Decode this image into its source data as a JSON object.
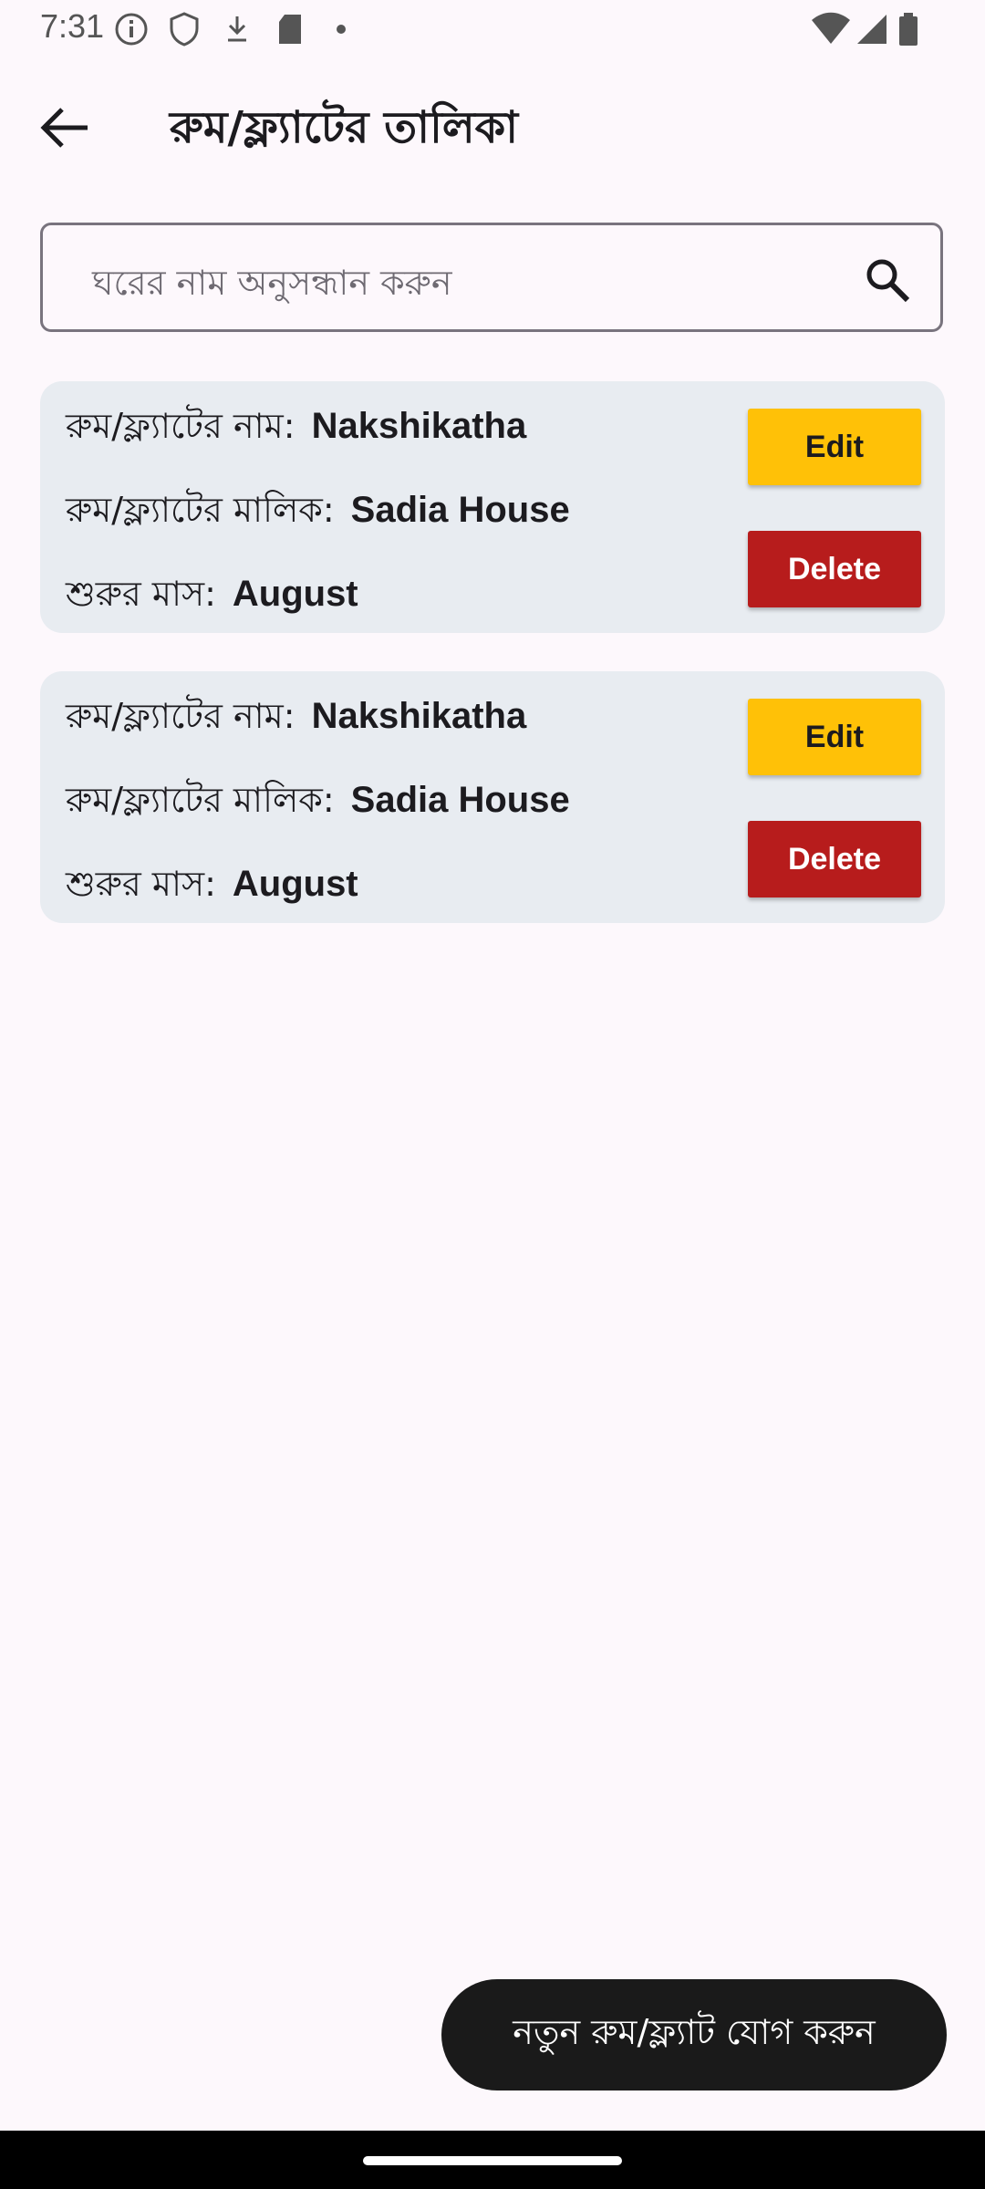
{
  "status_bar": {
    "time": "7:31",
    "left_icons": [
      "info-icon",
      "shield-icon",
      "download-icon",
      "sd-card-icon",
      "dot-icon"
    ],
    "right_icons": [
      "wifi-icon",
      "signal-icon",
      "battery-icon"
    ]
  },
  "app_bar": {
    "title": "রুম/ফ্ল্যাটের তালিকা",
    "back_icon": "arrow-left-icon"
  },
  "search": {
    "placeholder": "ঘরের নাম অনুসন্ধান করুন",
    "icon": "search-icon"
  },
  "cards": [
    {
      "name_label": "রুম/ফ্ল্যাটের নাম:",
      "name_value": "Nakshikatha",
      "owner_label": "রুম/ফ্ল্যাটের মালিক:",
      "owner_value": "Sadia House",
      "month_label": "শুরুর মাস:",
      "month_value": "August",
      "edit_label": "Edit",
      "delete_label": "Delete"
    },
    {
      "name_label": "রুম/ফ্ল্যাটের নাম:",
      "name_value": "Nakshikatha",
      "owner_label": "রুম/ফ্ল্যাটের মালিক:",
      "owner_value": "Sadia House",
      "month_label": "শুরুর মাস:",
      "month_value": "August",
      "edit_label": "Edit",
      "delete_label": "Delete"
    }
  ],
  "fab": {
    "label": "নতুন রুম/ফ্ল্যাট যোগ করুন"
  },
  "colors": {
    "background": "#fdf8fc",
    "card": "#e8ecf1",
    "edit": "#ffc107",
    "delete": "#b71c1c",
    "fab": "#1a1a1a"
  }
}
